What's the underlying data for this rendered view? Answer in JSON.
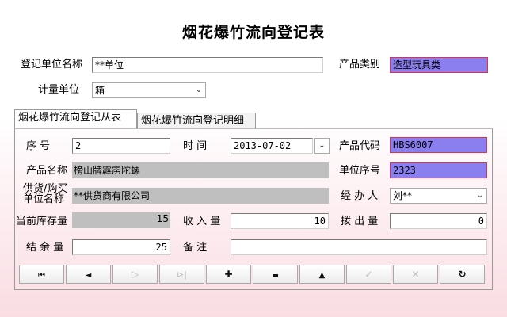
{
  "title": "烟花爆竹流向登记表",
  "header": {
    "unit_name_label": "登记单位名称",
    "unit_name_value": "**单位",
    "product_category_label": "产品类别",
    "product_category_value": "造型玩具类",
    "measure_unit_label": "计量单位",
    "measure_unit_value": "箱"
  },
  "tabs": [
    {
      "label": "烟花爆竹流向登记从表",
      "active": true
    },
    {
      "label": "烟花爆竹流向登记明细",
      "active": false
    }
  ],
  "form": {
    "seq_label": "序    号",
    "seq_value": "2",
    "time_label": "时    间",
    "time_value": "2013-07-02",
    "product_code_label": "产品代码",
    "product_code_value": "HBS6007",
    "product_name_label": "产品名称",
    "product_name_value": "榜山牌霹雳陀螺",
    "unit_seq_label": "单位序号",
    "unit_seq_value": "2323",
    "supplier_label_line1": "供货/购买",
    "supplier_label_line2": "单位名称",
    "supplier_value": "**供货商有限公司",
    "handler_label": "经 办 人",
    "handler_value": "刘**",
    "stock_label": "当前库存量",
    "stock_value": "15",
    "income_label": "收 入 量",
    "income_value": "10",
    "outgo_label": "拨 出 量",
    "outgo_value": "0",
    "balance_label": "结 余 量",
    "balance_value": "25",
    "remark_label": "备    注",
    "remark_value": ""
  },
  "toolbar": [
    {
      "name": "first-record-button",
      "icon": "first-icon",
      "glyph": "⏮",
      "enabled": true
    },
    {
      "name": "prev-record-button",
      "icon": "prev-icon",
      "glyph": "◄",
      "enabled": true
    },
    {
      "name": "next-record-button",
      "icon": "next-icon",
      "glyph": "▷",
      "enabled": false
    },
    {
      "name": "last-record-button",
      "icon": "last-icon",
      "glyph": "⊳|",
      "enabled": false
    },
    {
      "name": "add-record-button",
      "icon": "plus-icon",
      "glyph": "✚",
      "enabled": true
    },
    {
      "name": "delete-record-button",
      "icon": "minus-icon",
      "glyph": "▬",
      "enabled": true
    },
    {
      "name": "edit-record-button",
      "icon": "up-triangle-icon",
      "glyph": "▲",
      "enabled": true
    },
    {
      "name": "save-record-button",
      "icon": "check-icon",
      "glyph": "✓",
      "enabled": false
    },
    {
      "name": "cancel-record-button",
      "icon": "cross-icon",
      "glyph": "✕",
      "enabled": false
    },
    {
      "name": "refresh-button",
      "icon": "refresh-icon",
      "glyph": "↻",
      "enabled": true
    }
  ]
}
